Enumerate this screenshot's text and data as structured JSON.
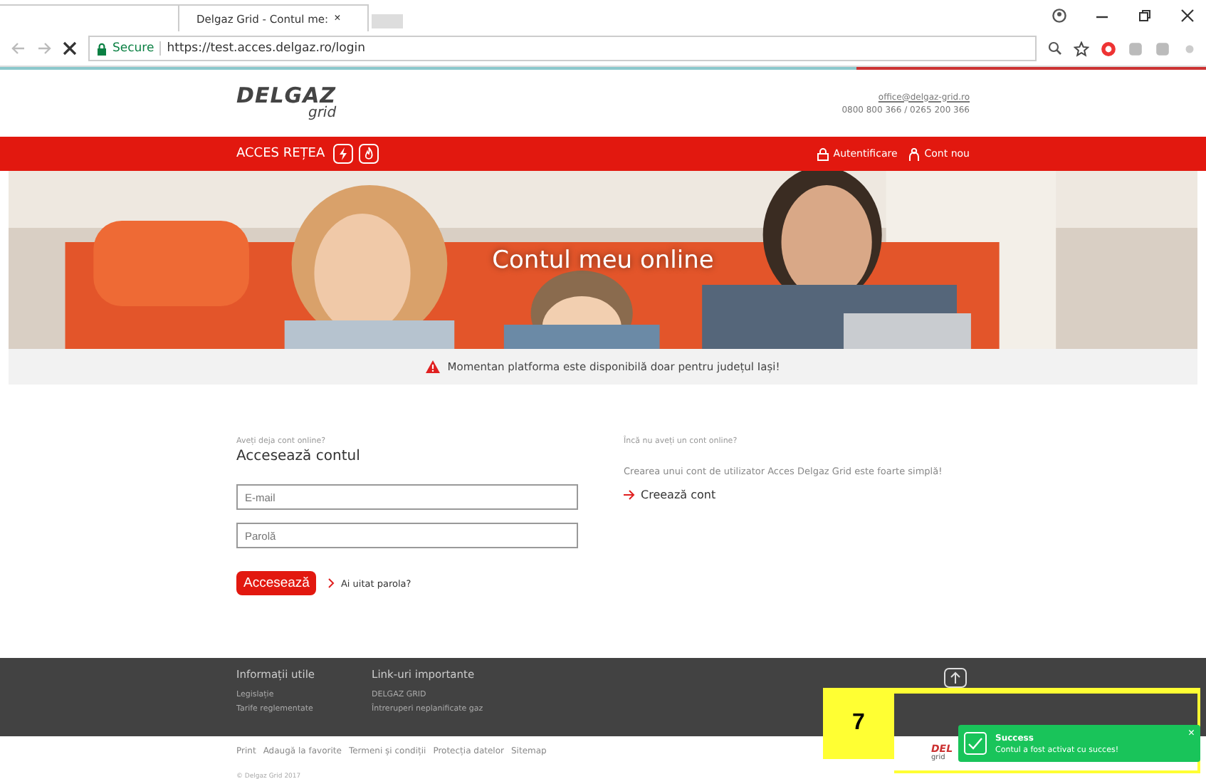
{
  "browser": {
    "tab_title": "Delgaz Grid - Contul me:",
    "tab_close": "×",
    "url_secure": "Secure",
    "url": "https://test.acces.delgaz.ro/login",
    "loading": true
  },
  "header": {
    "logo_main": "DELGAZ",
    "logo_sub": "grid",
    "email": "office@delgaz-grid.ro",
    "phones": "0800 800 366 / 0265 200 366"
  },
  "nav": {
    "brand": "ACCES REȚEA",
    "login": "Autentificare",
    "register": "Cont nou"
  },
  "hero": {
    "kind": "picture",
    "title": "Contul meu online"
  },
  "notice": "Momentan platforma este disponibilă doar pentru județul Iași!",
  "login": {
    "kicker": "Aveți deja cont online?",
    "title": "Accesează contul",
    "email_placeholder": "E-mail",
    "password_placeholder": "Parolă",
    "submit": "Accesează",
    "forgot": "Ai uitat parola?"
  },
  "register": {
    "kicker": "Încă nu aveți un cont online?",
    "text": "Crearea unui cont de utilizator Acces Delgaz Grid este foarte simplă!",
    "link": "Creează cont"
  },
  "footer": {
    "columns": [
      {
        "title": "Informații utile",
        "links": [
          "Legislație",
          "Tarife reglementate"
        ]
      },
      {
        "title": "Link-uri importante",
        "links": [
          "DELGAZ GRID",
          "Întreruperi neplanificate gaz"
        ]
      }
    ],
    "bottom_links": [
      "Print",
      "Adaugă la favorite",
      "Termeni și condiții",
      "Protecția datelor",
      "Sitemap"
    ],
    "copyright": "© Delgaz Grid 2017",
    "bottom_logo": "DEL",
    "bottom_logo_sub": "grid"
  },
  "toast": {
    "title": "Success",
    "message": "Contul a fost activat cu succes!",
    "close": "×"
  },
  "annotation": {
    "label": "7"
  }
}
